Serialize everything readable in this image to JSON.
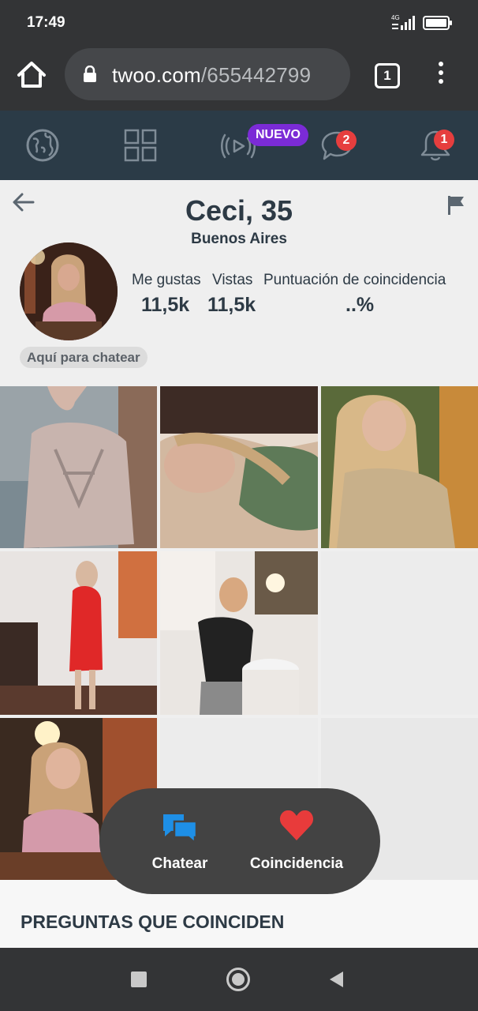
{
  "status_bar": {
    "time": "17:49",
    "network": "4G"
  },
  "browser": {
    "domain": "twoo.com",
    "path": "/655442799",
    "tab_count": "1"
  },
  "app_nav": {
    "new_badge": "NUEVO",
    "messages_count": "2",
    "notifications_count": "1"
  },
  "profile": {
    "name": "Ceci, 35",
    "city": "Buenos Aires",
    "stats": [
      {
        "label": "Me gustas",
        "value": "11,5k"
      },
      {
        "label": "Vistas",
        "value": "11,5k"
      },
      {
        "label": "Puntuación de coincidencia",
        "value": "..%"
      }
    ],
    "chat_pill": "Aquí para chatear"
  },
  "photos": [
    {
      "name": "photo-1"
    },
    {
      "name": "photo-2"
    },
    {
      "name": "photo-3"
    },
    {
      "name": "photo-4"
    },
    {
      "name": "photo-5"
    },
    {
      "name": "photo-6"
    }
  ],
  "actions": {
    "chat_label": "Chatear",
    "match_label": "Coincidencia"
  },
  "questions": {
    "title": "PREGUNTAS QUE COINCIDEN"
  },
  "colors": {
    "app_nav_bg": "#2b3b47",
    "badge_new": "#7b2bd6",
    "badge_count": "#e63e3e",
    "chat_icon": "#1e8fe6",
    "heart_icon": "#e83b3b"
  }
}
